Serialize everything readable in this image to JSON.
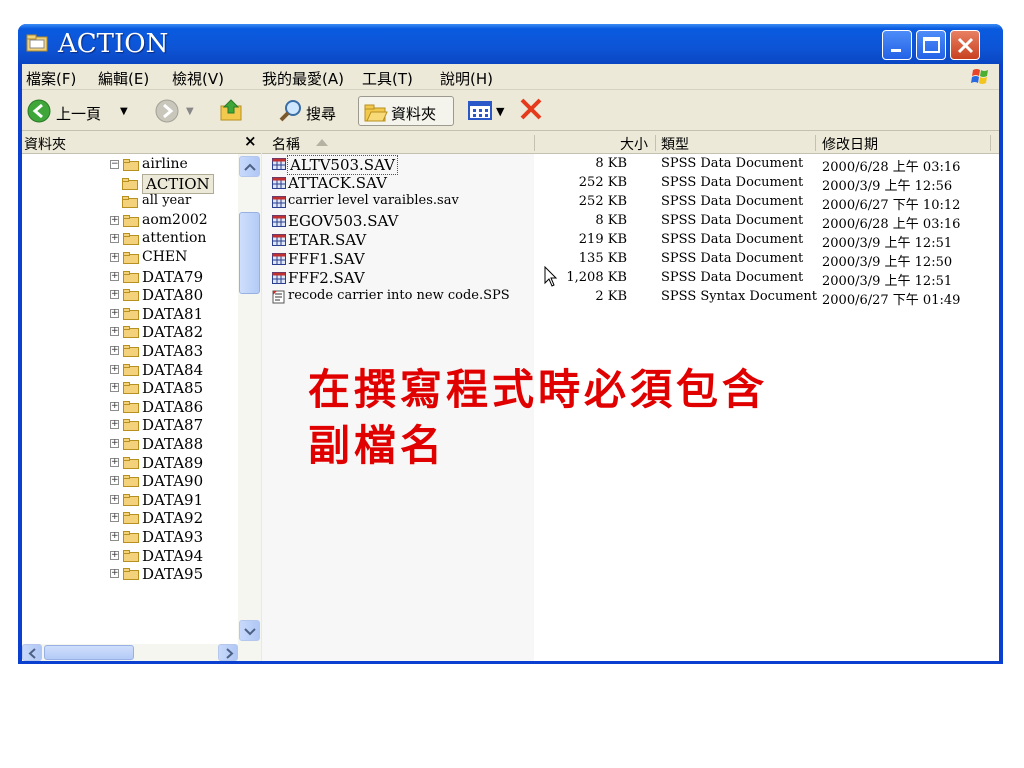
{
  "window": {
    "title": "ACTION",
    "accent": "#0a46c2"
  },
  "menubar": {
    "items": [
      "檔案(F)",
      "編輯(E)",
      "檢視(V)",
      "我的最愛(A)",
      "工具(T)",
      "說明(H)"
    ]
  },
  "toolbar": {
    "back_label": "上一頁",
    "search_label": "搜尋",
    "folders_label": "資料夾"
  },
  "tree": {
    "title": "資料夾",
    "close_glyph": "×",
    "nodes": [
      {
        "name": "airline",
        "expanded": true
      },
      {
        "name": "ACTION",
        "selected": true
      },
      {
        "name": "all year"
      },
      {
        "name": "aom2002"
      },
      {
        "name": "attention"
      },
      {
        "name": "CHEN"
      },
      {
        "name": "DATA79"
      },
      {
        "name": "DATA80"
      },
      {
        "name": "DATA81"
      },
      {
        "name": "DATA82"
      },
      {
        "name": "DATA83"
      },
      {
        "name": "DATA84"
      },
      {
        "name": "DATA85"
      },
      {
        "name": "DATA86"
      },
      {
        "name": "DATA87"
      },
      {
        "name": "DATA88"
      },
      {
        "name": "DATA89"
      },
      {
        "name": "DATA90"
      },
      {
        "name": "DATA91"
      },
      {
        "name": "DATA92"
      },
      {
        "name": "DATA93"
      },
      {
        "name": "DATA94"
      },
      {
        "name": "DATA95"
      }
    ]
  },
  "list": {
    "columns": {
      "name": "名稱",
      "size": "大小",
      "type": "類型",
      "modified": "修改日期"
    },
    "files": [
      {
        "name": "ALTV503.SAV",
        "size": "8 KB",
        "type": "SPSS Data Document",
        "modified": "2000/6/28 上午 03:16",
        "icon": "spss-data-icon"
      },
      {
        "name": "ATTACK.SAV",
        "size": "252 KB",
        "type": "SPSS Data Document",
        "modified": "2000/3/9 上午 12:56",
        "icon": "spss-data-icon"
      },
      {
        "name": "carrier  level varaibles.sav",
        "size": "252 KB",
        "type": "SPSS Data Document",
        "modified": "2000/6/27 下午 10:12",
        "icon": "spss-data-icon"
      },
      {
        "name": "EGOV503.SAV",
        "size": "8 KB",
        "type": "SPSS Data Document",
        "modified": "2000/6/28 上午 03:16",
        "icon": "spss-data-icon"
      },
      {
        "name": "ETAR.SAV",
        "size": "219 KB",
        "type": "SPSS Data Document",
        "modified": "2000/3/9 上午 12:51",
        "icon": "spss-data-icon"
      },
      {
        "name": "FFF1.SAV",
        "size": "135 KB",
        "type": "SPSS Data Document",
        "modified": "2000/3/9 上午 12:50",
        "icon": "spss-data-icon"
      },
      {
        "name": "FFF2.SAV",
        "size": "1,208 KB",
        "type": "SPSS Data Document",
        "modified": "2000/3/9 上午 12:51",
        "icon": "spss-data-icon"
      },
      {
        "name": "recode carrier into new code.SPS",
        "size": "2 KB",
        "type": "SPSS Syntax Document",
        "modified": "2000/6/27 下午 01:49",
        "icon": "spss-syntax-icon"
      }
    ]
  },
  "overlay": {
    "line1": "在撰寫程式時必須包含",
    "line2": "副檔名",
    "color": "#e00000"
  }
}
